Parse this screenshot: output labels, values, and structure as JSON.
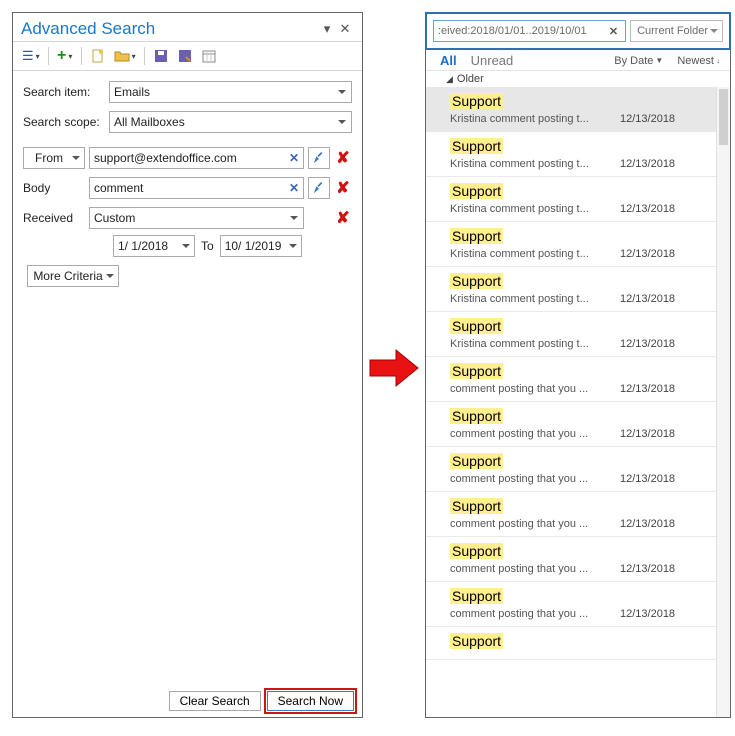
{
  "left": {
    "title": "Advanced Search",
    "search_item_label": "Search item:",
    "search_item_value": "Emails",
    "search_scope_label": "Search scope:",
    "search_scope_value": "All Mailboxes",
    "from_btn": "From",
    "from_value": "support@extendoffice.com",
    "body_label": "Body",
    "body_value": "comment",
    "received_label": "Received",
    "received_value": "Custom",
    "date_from": "1/  1/2018",
    "to_label": "To",
    "date_to": "10/  1/2019",
    "more_criteria": "More Criteria",
    "clear_btn": "Clear Search",
    "search_btn": "Search Now"
  },
  "right": {
    "search_token": ":eived:2018/01/01..2019/10/01",
    "folder_btn": "Current Folder",
    "tab_all": "All",
    "tab_unread": "Unread",
    "sort_by": "By Date",
    "sort_order": "Newest",
    "group_label": "Older",
    "messages": [
      {
        "from": "Support",
        "subj": "Kristina comment posting t...",
        "date": "12/13/2018",
        "selected": true
      },
      {
        "from": "Support",
        "subj": "Kristina comment posting t...",
        "date": "12/13/2018"
      },
      {
        "from": "Support",
        "subj": "Kristina comment posting t...",
        "date": "12/13/2018"
      },
      {
        "from": "Support",
        "subj": "Kristina comment posting t...",
        "date": "12/13/2018"
      },
      {
        "from": "Support",
        "subj": "Kristina comment posting t...",
        "date": "12/13/2018"
      },
      {
        "from": "Support",
        "subj": "Kristina comment posting t...",
        "date": "12/13/2018"
      },
      {
        "from": "Support",
        "subj": "comment posting that you ...",
        "date": "12/13/2018"
      },
      {
        "from": "Support",
        "subj": "comment posting that you ...",
        "date": "12/13/2018"
      },
      {
        "from": "Support",
        "subj": "comment posting that you ...",
        "date": "12/13/2018"
      },
      {
        "from": "Support",
        "subj": "comment posting that you ...",
        "date": "12/13/2018"
      },
      {
        "from": "Support",
        "subj": "comment posting that you ...",
        "date": "12/13/2018"
      },
      {
        "from": "Support",
        "subj": "comment posting that you ...",
        "date": "12/13/2018"
      },
      {
        "from": "Support",
        "subj": "",
        "date": ""
      }
    ]
  }
}
